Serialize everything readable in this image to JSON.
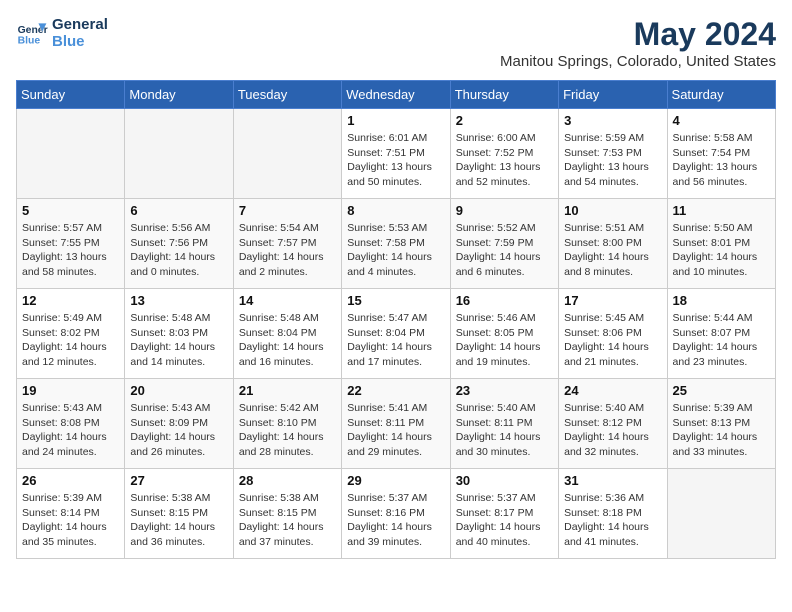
{
  "header": {
    "logo_line1": "General",
    "logo_line2": "Blue",
    "month": "May 2024",
    "location": "Manitou Springs, Colorado, United States"
  },
  "days_of_week": [
    "Sunday",
    "Monday",
    "Tuesday",
    "Wednesday",
    "Thursday",
    "Friday",
    "Saturday"
  ],
  "weeks": [
    [
      {
        "day": "",
        "info": ""
      },
      {
        "day": "",
        "info": ""
      },
      {
        "day": "",
        "info": ""
      },
      {
        "day": "1",
        "info": "Sunrise: 6:01 AM\nSunset: 7:51 PM\nDaylight: 13 hours\nand 50 minutes."
      },
      {
        "day": "2",
        "info": "Sunrise: 6:00 AM\nSunset: 7:52 PM\nDaylight: 13 hours\nand 52 minutes."
      },
      {
        "day": "3",
        "info": "Sunrise: 5:59 AM\nSunset: 7:53 PM\nDaylight: 13 hours\nand 54 minutes."
      },
      {
        "day": "4",
        "info": "Sunrise: 5:58 AM\nSunset: 7:54 PM\nDaylight: 13 hours\nand 56 minutes."
      }
    ],
    [
      {
        "day": "5",
        "info": "Sunrise: 5:57 AM\nSunset: 7:55 PM\nDaylight: 13 hours\nand 58 minutes."
      },
      {
        "day": "6",
        "info": "Sunrise: 5:56 AM\nSunset: 7:56 PM\nDaylight: 14 hours\nand 0 minutes."
      },
      {
        "day": "7",
        "info": "Sunrise: 5:54 AM\nSunset: 7:57 PM\nDaylight: 14 hours\nand 2 minutes."
      },
      {
        "day": "8",
        "info": "Sunrise: 5:53 AM\nSunset: 7:58 PM\nDaylight: 14 hours\nand 4 minutes."
      },
      {
        "day": "9",
        "info": "Sunrise: 5:52 AM\nSunset: 7:59 PM\nDaylight: 14 hours\nand 6 minutes."
      },
      {
        "day": "10",
        "info": "Sunrise: 5:51 AM\nSunset: 8:00 PM\nDaylight: 14 hours\nand 8 minutes."
      },
      {
        "day": "11",
        "info": "Sunrise: 5:50 AM\nSunset: 8:01 PM\nDaylight: 14 hours\nand 10 minutes."
      }
    ],
    [
      {
        "day": "12",
        "info": "Sunrise: 5:49 AM\nSunset: 8:02 PM\nDaylight: 14 hours\nand 12 minutes."
      },
      {
        "day": "13",
        "info": "Sunrise: 5:48 AM\nSunset: 8:03 PM\nDaylight: 14 hours\nand 14 minutes."
      },
      {
        "day": "14",
        "info": "Sunrise: 5:48 AM\nSunset: 8:04 PM\nDaylight: 14 hours\nand 16 minutes."
      },
      {
        "day": "15",
        "info": "Sunrise: 5:47 AM\nSunset: 8:04 PM\nDaylight: 14 hours\nand 17 minutes."
      },
      {
        "day": "16",
        "info": "Sunrise: 5:46 AM\nSunset: 8:05 PM\nDaylight: 14 hours\nand 19 minutes."
      },
      {
        "day": "17",
        "info": "Sunrise: 5:45 AM\nSunset: 8:06 PM\nDaylight: 14 hours\nand 21 minutes."
      },
      {
        "day": "18",
        "info": "Sunrise: 5:44 AM\nSunset: 8:07 PM\nDaylight: 14 hours\nand 23 minutes."
      }
    ],
    [
      {
        "day": "19",
        "info": "Sunrise: 5:43 AM\nSunset: 8:08 PM\nDaylight: 14 hours\nand 24 minutes."
      },
      {
        "day": "20",
        "info": "Sunrise: 5:43 AM\nSunset: 8:09 PM\nDaylight: 14 hours\nand 26 minutes."
      },
      {
        "day": "21",
        "info": "Sunrise: 5:42 AM\nSunset: 8:10 PM\nDaylight: 14 hours\nand 28 minutes."
      },
      {
        "day": "22",
        "info": "Sunrise: 5:41 AM\nSunset: 8:11 PM\nDaylight: 14 hours\nand 29 minutes."
      },
      {
        "day": "23",
        "info": "Sunrise: 5:40 AM\nSunset: 8:11 PM\nDaylight: 14 hours\nand 30 minutes."
      },
      {
        "day": "24",
        "info": "Sunrise: 5:40 AM\nSunset: 8:12 PM\nDaylight: 14 hours\nand 32 minutes."
      },
      {
        "day": "25",
        "info": "Sunrise: 5:39 AM\nSunset: 8:13 PM\nDaylight: 14 hours\nand 33 minutes."
      }
    ],
    [
      {
        "day": "26",
        "info": "Sunrise: 5:39 AM\nSunset: 8:14 PM\nDaylight: 14 hours\nand 35 minutes."
      },
      {
        "day": "27",
        "info": "Sunrise: 5:38 AM\nSunset: 8:15 PM\nDaylight: 14 hours\nand 36 minutes."
      },
      {
        "day": "28",
        "info": "Sunrise: 5:38 AM\nSunset: 8:15 PM\nDaylight: 14 hours\nand 37 minutes."
      },
      {
        "day": "29",
        "info": "Sunrise: 5:37 AM\nSunset: 8:16 PM\nDaylight: 14 hours\nand 39 minutes."
      },
      {
        "day": "30",
        "info": "Sunrise: 5:37 AM\nSunset: 8:17 PM\nDaylight: 14 hours\nand 40 minutes."
      },
      {
        "day": "31",
        "info": "Sunrise: 5:36 AM\nSunset: 8:18 PM\nDaylight: 14 hours\nand 41 minutes."
      },
      {
        "day": "",
        "info": ""
      }
    ]
  ]
}
